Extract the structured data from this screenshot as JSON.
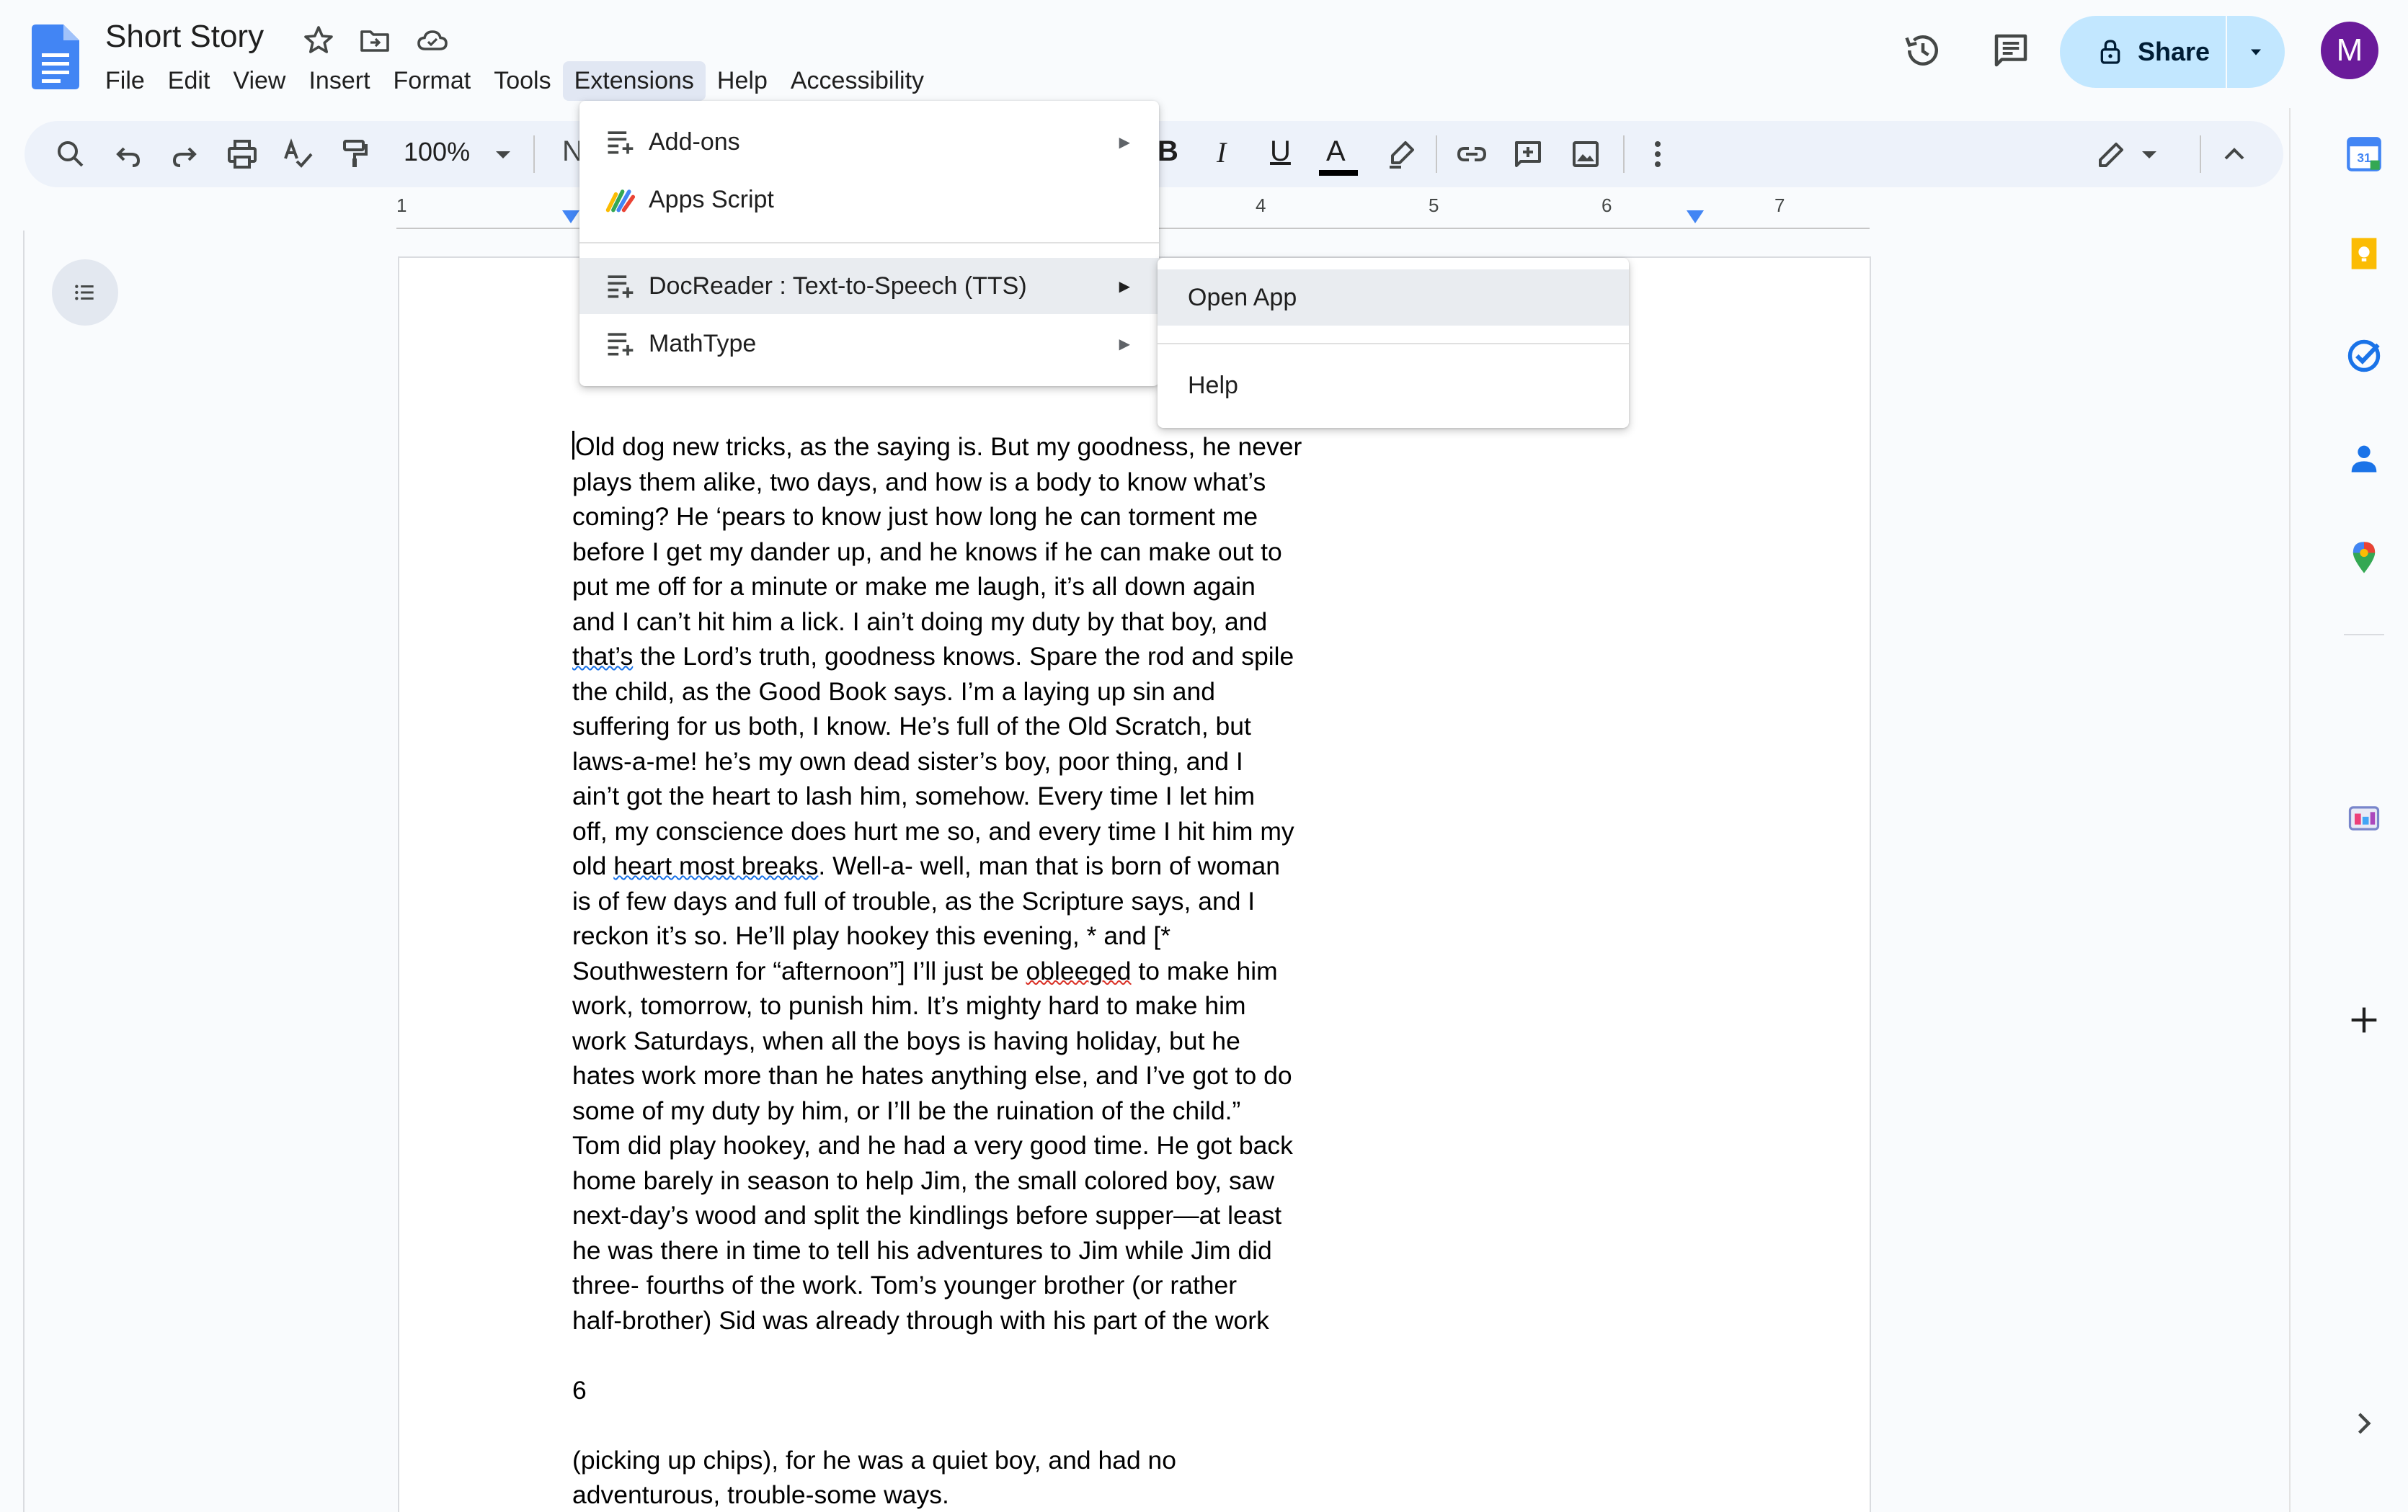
{
  "document": {
    "title": "Short Story"
  },
  "menubar": {
    "items": [
      "File",
      "Edit",
      "View",
      "Insert",
      "Format",
      "Tools",
      "Extensions",
      "Help",
      "Accessibility"
    ],
    "active": "Extensions"
  },
  "share": {
    "label": "Share"
  },
  "account": {
    "avatar_letter": "M",
    "avatar_color": "#6a1b9a"
  },
  "toolbar": {
    "zoom": "100%",
    "style_fragment": "N",
    "bold": "B",
    "italic": "I",
    "underline": "U",
    "text_color": "A"
  },
  "ruler": {
    "numbers": [
      "1",
      "4",
      "5",
      "6",
      "7"
    ]
  },
  "extensions_menu": {
    "items": [
      {
        "label": "Add-ons",
        "icon": "addon-list-icon",
        "submenu": true
      },
      {
        "label": "Apps Script",
        "icon": "apps-script-icon",
        "submenu": false
      },
      {
        "label": "DocReader : Text-to-Speech (TTS)",
        "icon": "addon-list-icon",
        "submenu": true,
        "highlighted": true
      },
      {
        "label": "MathType",
        "icon": "addon-list-icon",
        "submenu": true
      }
    ]
  },
  "docreader_submenu": {
    "items": [
      {
        "label": "Open App",
        "highlighted": true
      },
      {
        "label": "Help"
      }
    ]
  },
  "body": {
    "lines": [
      "Old dog new tricks, as the saying is. But my goodness, he never",
      "plays them alike, two days, and how is a body to know what’s",
      "coming? He ‘pears to know just how long he can torment me",
      "before I get my dander up, and he knows if he can make out to",
      "put me off for a minute or make me laugh, it’s all down again",
      "and I can’t hit him a lick. I ain’t doing my duty by that boy, and",
      "that’s the Lord’s truth, goodness knows. Spare the rod and spile",
      "the child, as the Good Book says. I’m a laying up sin and",
      "suffering for us both, I know. He’s full of the Old Scratch, but",
      "laws-a-me! he’s my own dead sister’s boy, poor thing, and I",
      "ain’t got the heart to lash him, somehow. Every time I let him",
      "off, my conscience does hurt me so, and every time I hit him my",
      "old heart most breaks. Well-a- well, man that is born of woman",
      "is of few days and full of trouble, as the Scripture says, and I",
      "reckon it’s so. He’ll play hookey this evening, * and [*",
      "Southwestern for “afternoon”] I’ll just be obleeged to make him",
      "work, tomorrow, to punish him. It’s mighty hard to make him",
      "work Saturdays, when all the boys is having holiday, but he",
      "hates work more than he hates anything else, and I’ve got to do",
      "some of my duty by him, or I’ll be the ruination of the child.”",
      "Tom did play hookey, and he had a very good time. He got back",
      "home barely in season to help Jim, the small colored boy, saw",
      "next-day’s wood and split the kindlings before supper—at least",
      "he was there in time to tell his adventures to Jim while Jim did",
      "three- fourths of the work. Tom’s younger brother (or rather",
      "half-brother) Sid was already through with his part of the work",
      "",
      "6",
      "",
      "(picking up chips), for he was a quiet boy, and had no",
      "adventurous, trouble-some ways."
    ]
  }
}
